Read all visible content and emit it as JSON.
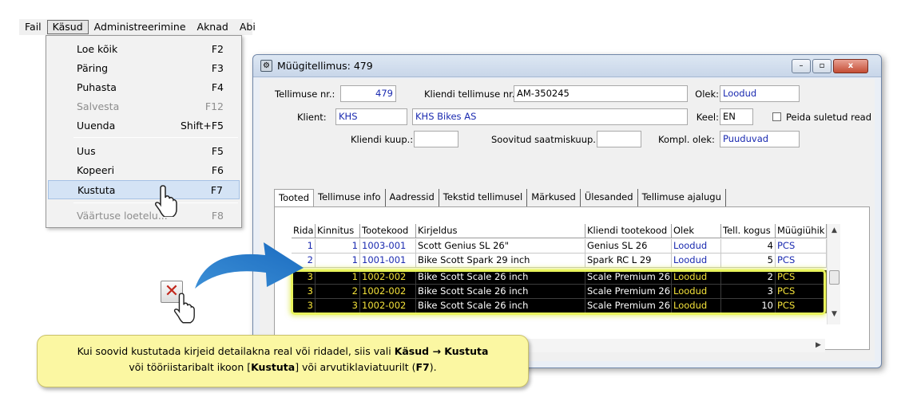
{
  "menubar": {
    "items": [
      "Fail",
      "Käsud",
      "Administreerimine",
      "Aknad",
      "Abi"
    ]
  },
  "menu": {
    "items": [
      {
        "label": "Loe kõik",
        "shortcut": "F2"
      },
      {
        "label": "Päring",
        "shortcut": "F3"
      },
      {
        "label": "Puhasta",
        "shortcut": "F4"
      },
      {
        "label": "Salvesta",
        "shortcut": "F12"
      },
      {
        "label": "Uuenda",
        "shortcut": "Shift+F5"
      },
      {
        "label": "Uus",
        "shortcut": "F5"
      },
      {
        "label": "Kopeeri",
        "shortcut": "F6"
      },
      {
        "label": "Kustuta",
        "shortcut": "F7"
      },
      {
        "label": "Väärtuse loetelu...",
        "shortcut": "F8"
      }
    ]
  },
  "window": {
    "title": "Müügitellimus: 479",
    "buttons": {
      "minimize": "–",
      "restore": "▫",
      "close": "x"
    }
  },
  "form": {
    "order_no_label": "Tellimuse nr.:",
    "order_no": "479",
    "client_order_label": "Kliendi tellimuse nr.:",
    "client_order": "AM-350245",
    "status_label": "Olek:",
    "status": "Loodud",
    "client_label": "Klient:",
    "client_code": "KHS",
    "client_name": "KHS Bikes AS",
    "lang_label": "Keel:",
    "lang": "EN",
    "hide_closed_label": "Peida suletud read",
    "client_date_label": "Kliendi kuup.:",
    "client_date": "",
    "wish_date_label": "Soovitud saatmiskuup.:",
    "wish_date": "",
    "kompl_label": "Kompl. olek:",
    "kompl": "Puuduvad"
  },
  "tabs": [
    "Tooted",
    "Tellimuse info",
    "Aadressid",
    "Tekstid tellimusel",
    "Märkused",
    "Ülesanded",
    "Tellimuse ajalugu"
  ],
  "grid": {
    "columns": [
      "Rida",
      "Kinnitus",
      "Tootekood",
      "Kirjeldus",
      "Kliendi tootekood",
      "Olek",
      "Tell. kogus",
      "Müügiühik"
    ],
    "rows": [
      [
        "1",
        "1",
        "1003-001",
        "Scott Genius SL 26\"",
        "Genius SL 26",
        "Loodud",
        "4",
        "PCS"
      ],
      [
        "2",
        "1",
        "1001-001",
        "Bike Scott Spark 29 inch",
        "Spark RC L 29",
        "Loodud",
        "5",
        "PCS"
      ],
      [
        "3",
        "1",
        "1002-002",
        "Bike Scott Scale 26 inch",
        "Scale Premium 26",
        "Loodud",
        "2",
        "PCS"
      ],
      [
        "3",
        "2",
        "1002-002",
        "Bike Scott Scale 26 inch",
        "Scale Premium 26",
        "Loodud",
        "3",
        "PCS"
      ],
      [
        "3",
        "3",
        "1002-002",
        "Bike Scott Scale 26 inch",
        "Scale Premium 26",
        "Loodud",
        "10",
        "PCS"
      ]
    ]
  },
  "callout": {
    "line1_a": "Kui soovid kustutada kirjeid detailakna real või ridadel, siis vali ",
    "line1_b": "Käsud",
    "line1_c": " → ",
    "line1_d": "Kustuta",
    "line2_a": "või tööriistaribalt ikoon [",
    "line2_b": "Kustuta",
    "line2_c": "] või arvutiklaviatuurilt (",
    "line2_d": "F7",
    "line2_e": ")."
  },
  "icons": {
    "delete": "delete-x-icon",
    "hand": "hand-cursor-icon"
  }
}
